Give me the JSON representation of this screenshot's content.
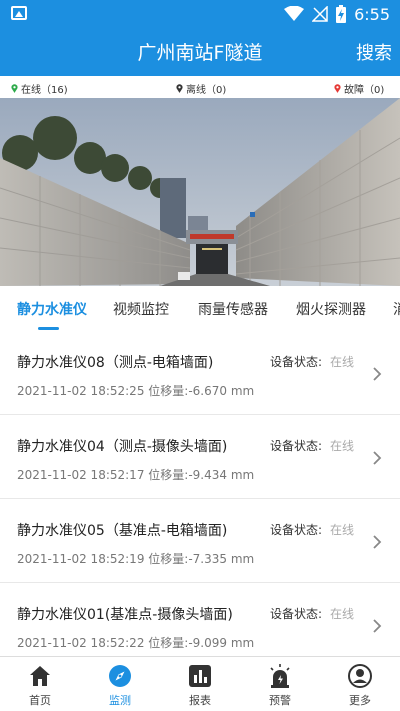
{
  "status_bar": {
    "time": "6:55"
  },
  "header": {
    "title": "广州南站F隧道",
    "search_label": "搜索"
  },
  "legend": {
    "online": "在线（16)",
    "offline": "离线（0)",
    "fault": "故障（0)"
  },
  "tabs": [
    {
      "label": "静力水准仪",
      "active": true
    },
    {
      "label": "视频监控"
    },
    {
      "label": "雨量传感器"
    },
    {
      "label": "烟火探测器"
    },
    {
      "label": "消"
    }
  ],
  "devices": [
    {
      "name": "静力水准仪08（测点-电箱墙面)",
      "datetime": "2021-11-02 18:52:25",
      "displacement_label": "位移量:",
      "displacement": "-6.670 mm",
      "status_label": "设备状态:",
      "status": "在线"
    },
    {
      "name": "静力水准仪04（测点-摄像头墙面)",
      "datetime": "2021-11-02 18:52:17",
      "displacement_label": "位移量:",
      "displacement": "-9.434 mm",
      "status_label": "设备状态:",
      "status": "在线"
    },
    {
      "name": "静力水准仪05（基准点-电箱墙面)",
      "datetime": "2021-11-02 18:52:19",
      "displacement_label": "位移量:",
      "displacement": "-7.335 mm",
      "status_label": "设备状态:",
      "status": "在线"
    },
    {
      "name": "静力水准仪01(基准点-摄像头墙面)",
      "datetime": "2021-11-02 18:52:22",
      "displacement_label": "位移量:",
      "displacement": "-9.099 mm",
      "status_label": "设备状态:",
      "status": "在线"
    }
  ],
  "bottom_nav": [
    {
      "label": "首页",
      "icon": "home-icon"
    },
    {
      "label": "监测",
      "icon": "compass-icon",
      "active": true
    },
    {
      "label": "报表",
      "icon": "chart-icon"
    },
    {
      "label": "预警",
      "icon": "alarm-icon"
    },
    {
      "label": "更多",
      "icon": "user-icon"
    }
  ],
  "colors": {
    "primary": "#1c8fe0",
    "online_pin": "#2eaa4a",
    "offline_pin": "#333333",
    "fault_pin": "#e53935"
  }
}
